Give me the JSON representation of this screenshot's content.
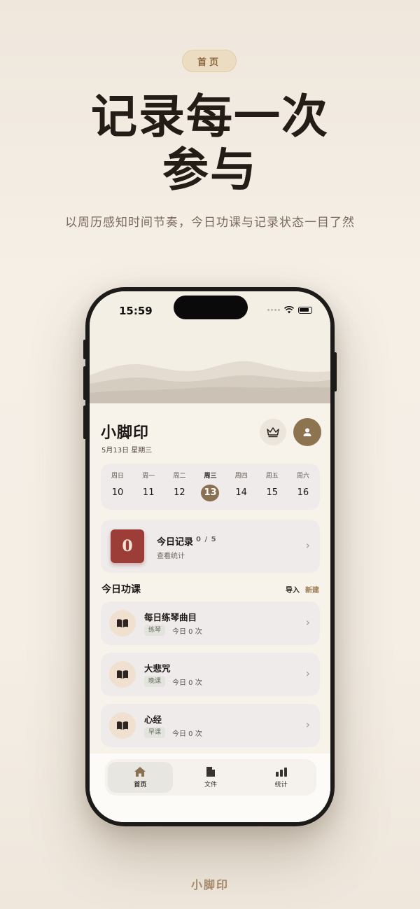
{
  "hero": {
    "pill": "首页",
    "headline_line1": "记录每一次",
    "headline_line2": "参与",
    "subtitle": "以周历感知时间节奏，今日功课与记录状态一目了然"
  },
  "status_bar": {
    "time": "15:59"
  },
  "app": {
    "title": "小脚印",
    "date": "5月13日 星期三"
  },
  "week": [
    {
      "name": "周日",
      "num": "10",
      "active": false
    },
    {
      "name": "周一",
      "num": "11",
      "active": false
    },
    {
      "name": "周二",
      "num": "12",
      "active": false
    },
    {
      "name": "周三",
      "num": "13",
      "active": true
    },
    {
      "name": "周四",
      "num": "14",
      "active": false
    },
    {
      "name": "周五",
      "num": "15",
      "active": false
    },
    {
      "name": "周六",
      "num": "16",
      "active": false
    }
  ],
  "record": {
    "badge": "0",
    "title": "今日记录",
    "count": "0 / 5",
    "sub": "查看统计"
  },
  "lessons_section": {
    "title": "今日功课",
    "import": "导入",
    "new": "新建"
  },
  "lessons": [
    {
      "title": "每日练琴曲目",
      "tag": "练琴",
      "count": "今日 0 次"
    },
    {
      "title": "大悲咒",
      "tag": "晚课",
      "count": "今日 0 次"
    },
    {
      "title": "心经",
      "tag": "早课",
      "count": "今日 0 次"
    }
  ],
  "tabs": [
    {
      "label": "首页",
      "icon": "home-icon"
    },
    {
      "label": "文件",
      "icon": "file-icon"
    },
    {
      "label": "统计",
      "icon": "stats-icon"
    }
  ],
  "footer": {
    "brand": "小脚印"
  },
  "colors": {
    "accent": "#8a7152",
    "record_badge": "#9d3d37",
    "background": "#f4eee5"
  }
}
